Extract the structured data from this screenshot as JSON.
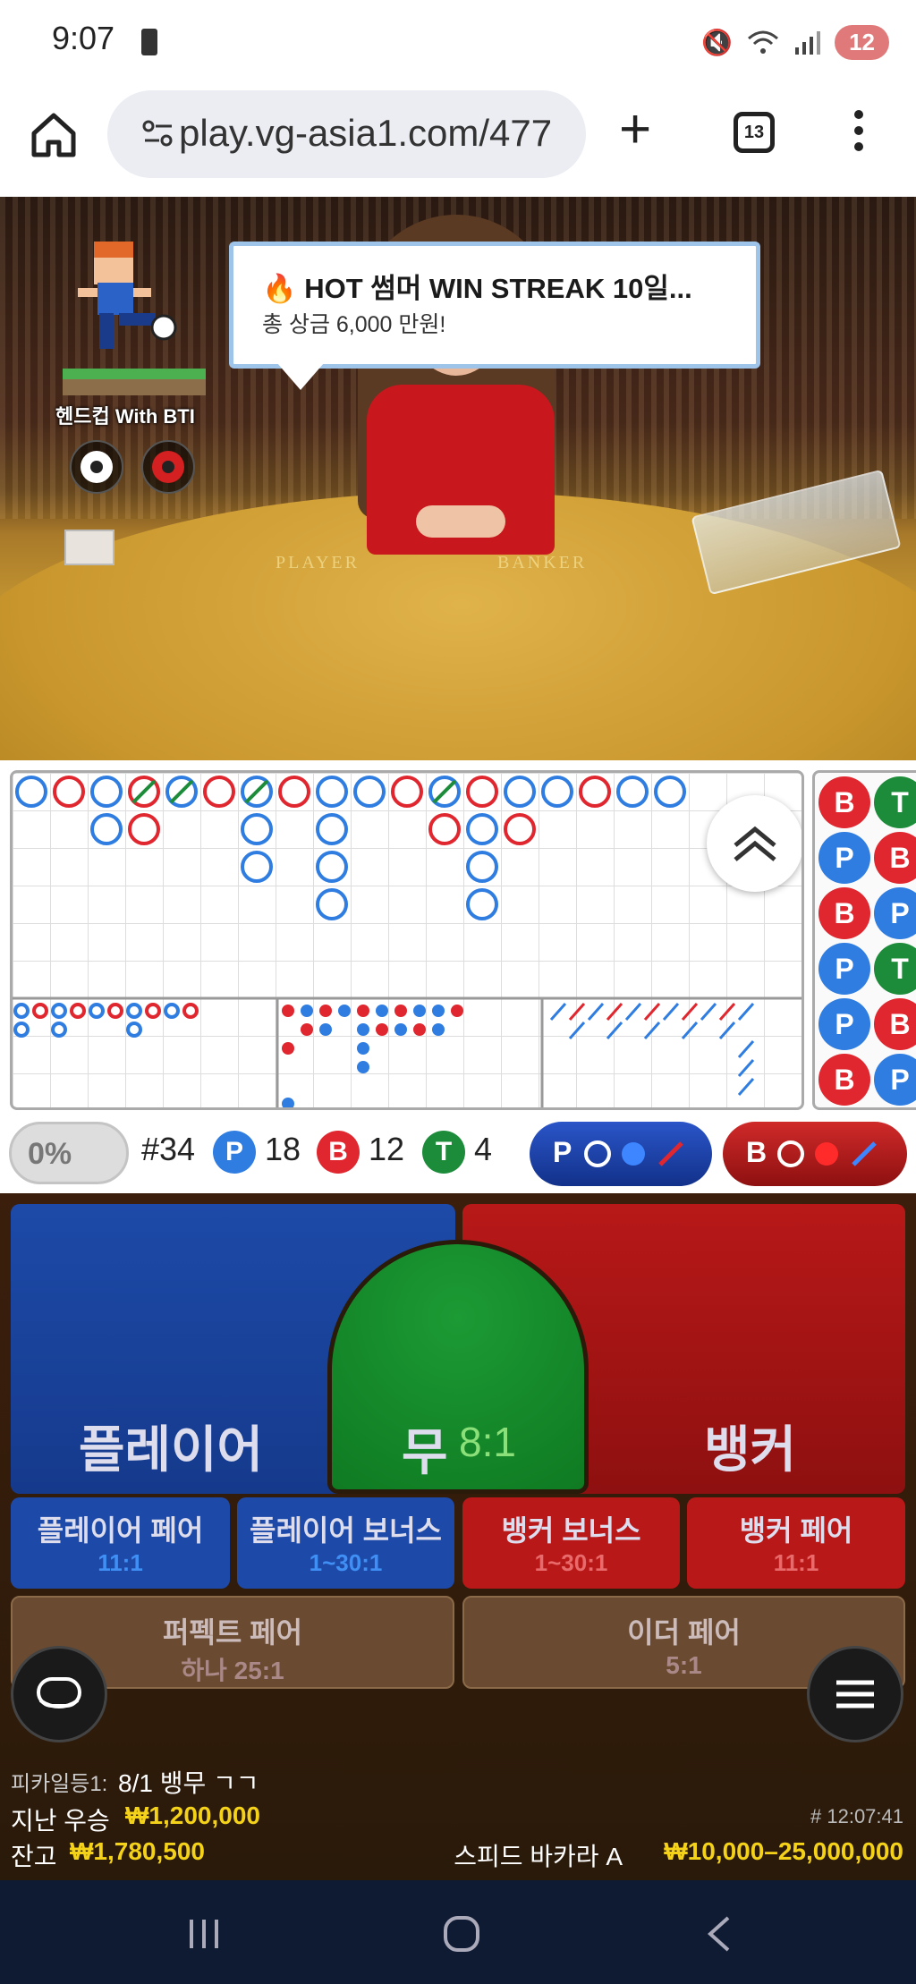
{
  "status_bar": {
    "time": "9:07",
    "notification_count": "12"
  },
  "browser": {
    "url": "play.vg-asia1.com/477",
    "tab_count": "13"
  },
  "video": {
    "banner_title": "🔥 HOT 썸머 WIN STREAK 10일...",
    "banner_subtitle": "총 상금 6,000 만원!",
    "mascot_name": "헨드컵 With BTI",
    "felt_player": "PLAYER",
    "felt_banker": "BANKER"
  },
  "side_road": [
    "B",
    "T",
    "P",
    "B",
    "B",
    "P",
    "P",
    "T",
    "P",
    "B",
    "B",
    "P"
  ],
  "stats": {
    "percent": "0%",
    "round": "#34",
    "player_label": "P",
    "player_count": "18",
    "banker_label": "B",
    "banker_count": "12",
    "tie_label": "T",
    "tie_count": "4",
    "player_predict_label": "P",
    "banker_predict_label": "B"
  },
  "bets": {
    "player": "플레이어",
    "tie": "무",
    "tie_odds": "8:1",
    "banker": "뱅커",
    "player_pair": "플레이어 페어",
    "player_pair_odds": "11:1",
    "player_bonus": "플레이어 보너스",
    "player_bonus_odds": "1~30:1",
    "banker_bonus": "뱅커 보너스",
    "banker_bonus_odds": "1~30:1",
    "banker_pair": "뱅커 페어",
    "banker_pair_odds": "11:1",
    "perfect_pair": "퍼펙트 페어",
    "perfect_pair_odds": "하나 25:1",
    "either_pair": "이더 페어",
    "either_pair_odds": "5:1"
  },
  "info": {
    "chat_user": "피카일등1:",
    "chat_msg": "8/1 뱅무 ㄱㄱ",
    "last_win_label": "지난 우승",
    "last_win_amount": "₩1,200,000",
    "balance_label": "잔고",
    "balance_amount": "₩1,780,500",
    "round_time": "# 12:07:41",
    "table_name": "스피드 바카라 A",
    "bet_limit": "₩10,000–25,000,000"
  },
  "colors": {
    "player": "#2f7de1",
    "banker": "#e0262e",
    "tie": "#1c8c3a",
    "gold": "#f5d21a"
  },
  "icons": [
    "home-icon",
    "tune-icon",
    "plus-icon",
    "tabs-icon",
    "more-vert-icon",
    "chevron-up-icon",
    "chat-icon",
    "hamburger-icon",
    "recents-icon",
    "home-nav-icon",
    "back-icon"
  ]
}
